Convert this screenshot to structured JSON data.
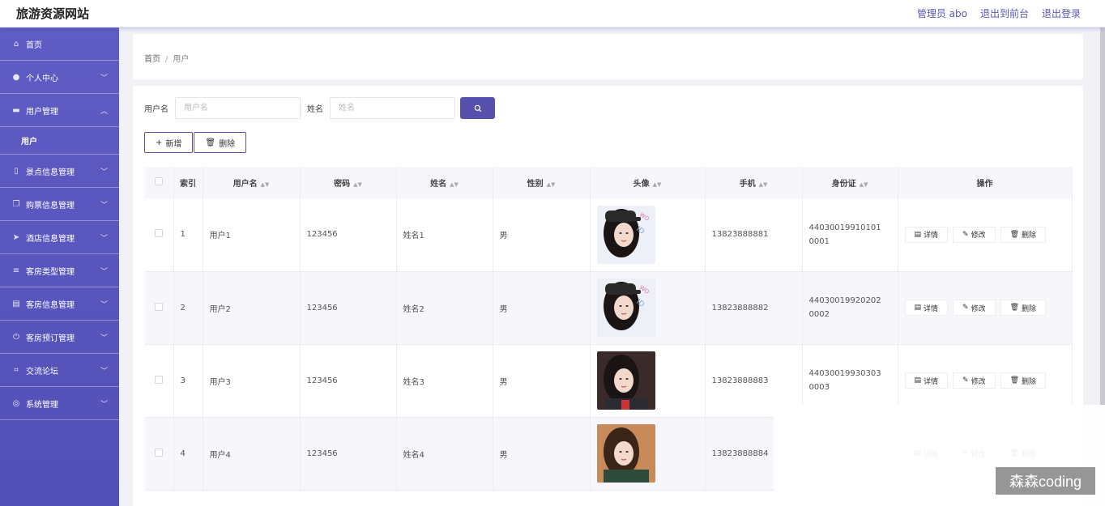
{
  "header": {
    "title": "旅游资源网站",
    "admin": "管理员 abo",
    "front": "退出到前台",
    "logout": "退出登录"
  },
  "sidebar": {
    "items": [
      {
        "label": "首页",
        "icon": "home-icon",
        "chevron": ""
      },
      {
        "label": "个人中心",
        "icon": "user-icon",
        "chevron": "down"
      },
      {
        "label": "用户管理",
        "icon": "briefcase-icon",
        "chevron": "up"
      },
      {
        "label": "用户",
        "icon": "",
        "chevron": "",
        "sub": true
      },
      {
        "label": "景点信息管理",
        "icon": "mobile-icon",
        "chevron": "down"
      },
      {
        "label": "购票信息管理",
        "icon": "copy-icon",
        "chevron": "down"
      },
      {
        "label": "酒店信息管理",
        "icon": "send-icon",
        "chevron": "down"
      },
      {
        "label": "客房类型管理",
        "icon": "list-icon",
        "chevron": "down"
      },
      {
        "label": "客房信息管理",
        "icon": "clipboard-icon",
        "chevron": "down"
      },
      {
        "label": "客房预订管理",
        "icon": "power-icon",
        "chevron": "down"
      },
      {
        "label": "交流论坛",
        "icon": "crop-icon",
        "chevron": "down"
      },
      {
        "label": "系统管理",
        "icon": "globe-icon",
        "chevron": "down"
      }
    ]
  },
  "breadcrumb": {
    "home": "首页",
    "sep": "/",
    "current": "用户"
  },
  "search": {
    "username_label": "用户名",
    "username_placeholder": "用户名",
    "name_label": "姓名",
    "name_placeholder": "姓名"
  },
  "actions": {
    "add": "新增",
    "delete": "删除"
  },
  "table": {
    "columns": [
      "索引",
      "用户名",
      "密码",
      "姓名",
      "性别",
      "头像",
      "手机",
      "身份证",
      "操作"
    ],
    "rows": [
      {
        "index": "1",
        "username": "用户1",
        "password": "123456",
        "name": "姓名1",
        "gender": "男",
        "avatar": "photo-cap",
        "phone": "13823888881",
        "id_card": "440300199101010001"
      },
      {
        "index": "2",
        "username": "用户2",
        "password": "123456",
        "name": "姓名2",
        "gender": "男",
        "avatar": "photo-cap",
        "phone": "13823888882",
        "id_card": "440300199202020002"
      },
      {
        "index": "3",
        "username": "用户3",
        "password": "123456",
        "name": "姓名3",
        "gender": "男",
        "avatar": "photo-dark",
        "phone": "13823888883",
        "id_card": "440300199303030003"
      },
      {
        "index": "4",
        "username": "用户4",
        "password": "123456",
        "name": "姓名4",
        "gender": "男",
        "avatar": "photo-warm",
        "phone": "13823888884",
        "id_card": ""
      }
    ],
    "op_labels": {
      "detail": "详情",
      "edit": "修改",
      "delete": "删除"
    }
  },
  "watermark": "森森coding",
  "colors": {
    "primary": "#5651ad",
    "sidebar": "#5a57be"
  }
}
